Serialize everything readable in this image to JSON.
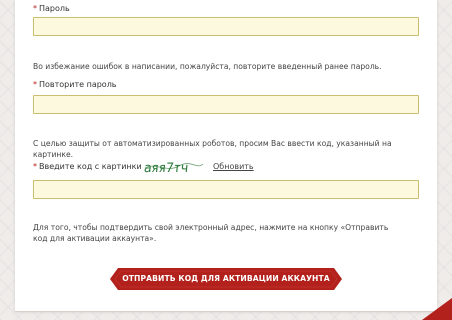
{
  "form": {
    "password_label": "Пароль",
    "password_required_mark": "*",
    "repeat_hint": "Во избежание ошибок в написании, пожалуйста, повторите введенный ранее пароль.",
    "repeat_label": "Повторите пароль",
    "repeat_required_mark": "*",
    "captcha_hint": "С целью защиты от автоматизированных роботов, просим Вас ввести код, указанный на картинке.",
    "captcha_label": "Введите код с картинки",
    "captcha_required_mark": "*",
    "captcha_text": "аяя7тч",
    "refresh_link": "Обновить",
    "email_hint": "Для того, чтобы подтвердить свой электронный адрес, нажмите на кнопку «Отправить код для активации аккаунта».",
    "submit_label": "ОТПРАВИТЬ КОД ДЛЯ АКТИВАЦИИ АККАУНТА"
  },
  "fields": {
    "password_value": "",
    "repeat_value": "",
    "captcha_value": ""
  },
  "colors": {
    "accent": "#b3211c",
    "field_bg": "#fdf9df",
    "field_border": "#cdbd6e",
    "captcha_ink": "#2f7b3e"
  }
}
